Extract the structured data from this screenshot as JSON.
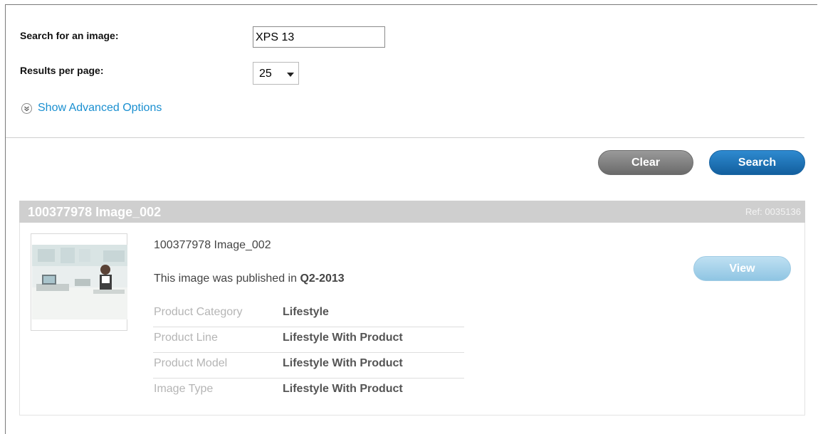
{
  "search": {
    "label": "Search for an image:",
    "value": "XPS 13",
    "results_label": "Results per page:",
    "results_value": "25",
    "advanced_link": "Show Advanced Options",
    "advanced_icon": "expand-circle-icon"
  },
  "actions": {
    "clear_label": "Clear",
    "search_label": "Search"
  },
  "result": {
    "header_title": "100377978 Image_002",
    "ref": "Ref: 0035136",
    "title": "100377978 Image_002",
    "published_prefix": "This image was published in ",
    "published_value": "Q2-2013",
    "view_label": "View",
    "attributes": [
      {
        "key": "Product Category",
        "value": "Lifestyle"
      },
      {
        "key": "Product Line",
        "value": "Lifestyle With Product"
      },
      {
        "key": "Product Model",
        "value": "Lifestyle With Product"
      },
      {
        "key": "Image Type",
        "value": "Lifestyle With Product"
      }
    ]
  },
  "colors": {
    "link": "#1a8fd0",
    "search_button": "#1a6fb5",
    "clear_button": "#7d7d7d",
    "view_button": "#a6d3ec",
    "result_header": "#cfcfcf"
  }
}
